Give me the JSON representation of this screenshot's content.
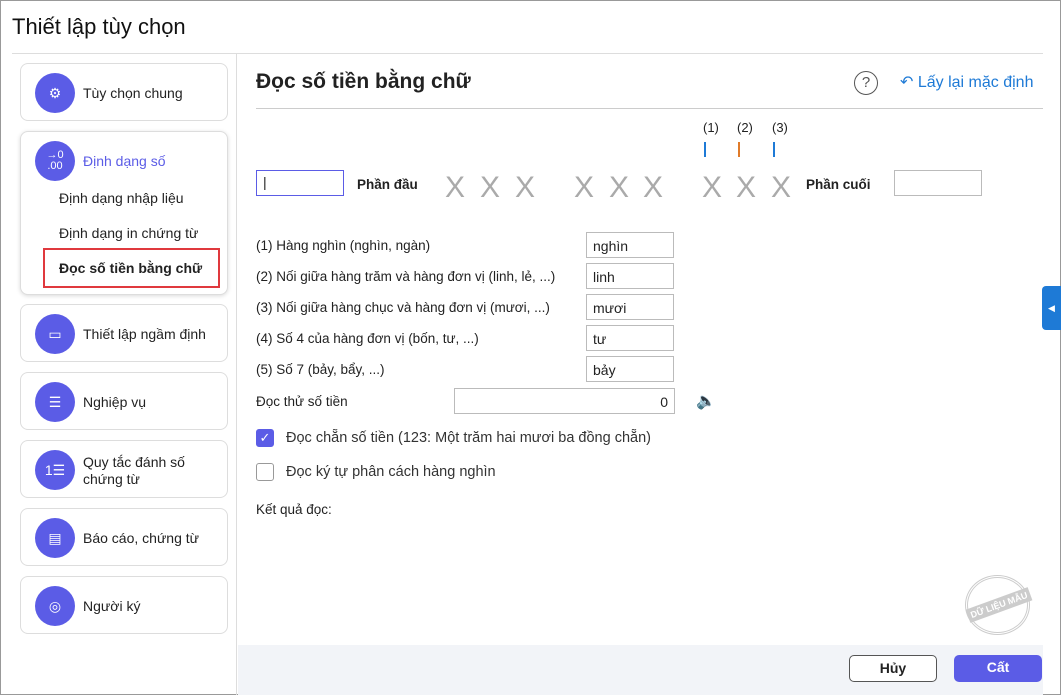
{
  "title": "Thiết lập tùy chọn",
  "sidebar": {
    "general": "Tùy chọn chung",
    "number_format": "Định dạng số",
    "number_format_icon_text": "→0 .00",
    "sub": [
      "Định dạng nhập liệu",
      "Định dạng in chứng từ",
      "Đọc số tiền bằng chữ"
    ],
    "defaults": "Thiết lập ngầm định",
    "business": "Nghiệp vụ",
    "numbering": "Quy tắc đánh số chứng từ",
    "reports": "Báo cáo, chứng từ",
    "signer": "Người ký"
  },
  "main": {
    "heading": "Đọc số tiền bằng chữ",
    "help": "?",
    "reset": "↶ Lấy lại mặc định",
    "markers": [
      "(1)",
      "(2)",
      "(3)"
    ],
    "marker_colors": [
      "#1e7ad6",
      "#e07b2a",
      "#1e7ad6"
    ],
    "prefix_value": "|",
    "prefix_label": "Phần đầu",
    "suffix_label": "Phần cuối",
    "suffix_value": "",
    "placeholder_x": "X",
    "options": [
      {
        "label": "(1) Hàng nghìn (nghìn, ngàn)",
        "value": "nghìn"
      },
      {
        "label": "(2) Nối giữa hàng trăm và hàng đơn vị (linh, lẻ, ...)",
        "value": "linh"
      },
      {
        "label": "(3) Nối giữa hàng chục và hàng đơn vị (mươi, ...)",
        "value": "mươi"
      },
      {
        "label": "(4) Số 4 của hàng đơn vị (bốn, tư, ...)",
        "value": "tư"
      },
      {
        "label": "(5) Số 7 (bảy, bẩy, ...)",
        "value": "bảy"
      }
    ],
    "test_label": "Đọc thử số tiền",
    "test_value": "0",
    "check1": "Đọc chẵn số tiền (123: Một trăm hai mươi ba đồng chẵn)",
    "check1_checked": true,
    "check2": "Đọc ký tự phân cách hàng nghìn",
    "check2_checked": false,
    "result_label": "Kết quả đọc:",
    "stamp": "DỮ LIỆU MẪU"
  },
  "footer": {
    "cancel": "Hủy",
    "save": "Cất"
  },
  "colors": {
    "accent": "#5b5ce6",
    "link": "#1e7ad6",
    "highlight": "#e0393e"
  }
}
